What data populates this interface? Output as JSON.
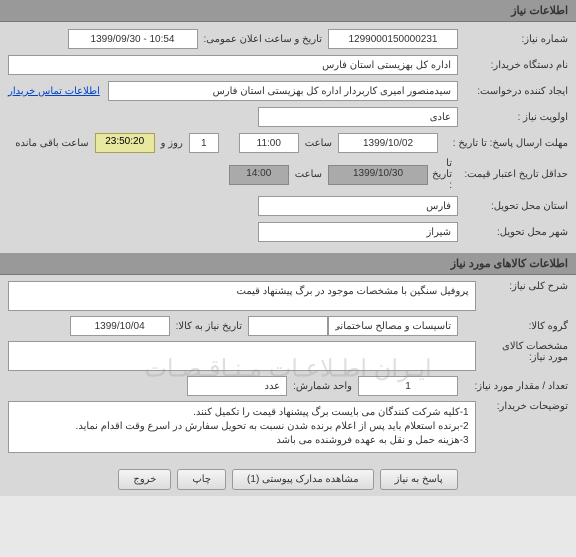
{
  "section1": {
    "title": "اطلاعات نیاز",
    "request_no_label": "شماره نیاز:",
    "request_no": "1299000150000231",
    "announce_label": "تاریخ و ساعت اعلان عمومی:",
    "announce_value": "1399/09/30 - 10:54",
    "buyer_org_label": "نام دستگاه خریدار:",
    "buyer_org": "اداره کل بهزیستی استان فارس",
    "requester_label": "ایجاد کننده درخواست:",
    "requester": "سیدمنصور امیری کاربردار اداره کل بهزیستی استان فارس",
    "contact_link": "اطلاعات تماس خریدار",
    "priority_label": "اولویت نیاز :",
    "priority": "عادی",
    "deadline_label": "مهلت ارسال پاسخ:  تا تاریخ :",
    "deadline_date": "1399/10/02",
    "time_label": "ساعت",
    "deadline_time": "11:00",
    "days": "1",
    "days_label": "روز و",
    "remaining_time": "23:50:20",
    "remaining_label": "ساعت باقی مانده",
    "validity_label": "حداقل تاریخ اعتبار قیمت:",
    "validity_until_label": "تا تاریخ :",
    "validity_date": "1399/10/30",
    "validity_time": "14:00",
    "province_label": "استان محل تحویل:",
    "province": "فارس",
    "city_label": "شهر محل تحویل:",
    "city": "شیراز"
  },
  "section2": {
    "title": "اطلاعات کالاهای مورد نیاز",
    "desc_label": "شرح کلی نیاز:",
    "desc": "پروفیل سنگین با مشخصات موجود در برگ پیشنهاد قیمت",
    "group_label": "گروه کالا:",
    "group": "تاسیسات و مصالح ساختمانی",
    "need_date_label": "تاریخ نیاز به کالا:",
    "need_date": "1399/10/04",
    "spec_label": "مشخصات کالای مورد نیاز:",
    "spec": "",
    "qty_label": "تعداد / مقدار مورد نیاز:",
    "qty": "1",
    "unit_label": "واحد شمارش:",
    "unit": "عدد",
    "notes_label": "توضیحات خریدار:",
    "notes": "1-کلیه شرکت کنندگان می بایست برگ پیشنهاد قیمت را تکمیل کنند.\n2-برنده استعلام باید پس از اعلام برنده شدن نسبت به تحویل سفارش در اسرع وقت اقدام نماید.\n3-هزینه حمل و نقل به عهده فروشنده می باشد",
    "watermark": "ایـران اطـلاعـات مـنـاقـصـات"
  },
  "buttons": {
    "reply": "پاسخ به نیاز",
    "attachments": "مشاهده مدارک پیوستی (1)",
    "print": "چاپ",
    "exit": "خروج"
  }
}
